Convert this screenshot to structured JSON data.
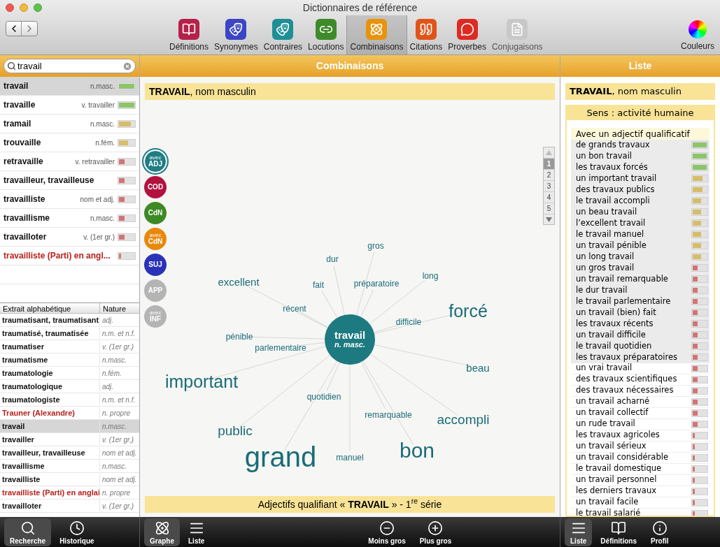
{
  "window": {
    "title": "Dictionnaires de référence"
  },
  "toolbar": [
    {
      "label": "Définitions",
      "kind": "book",
      "color": "#b5214a",
      "selected": false,
      "disabled": false
    },
    {
      "label": "Synonymes",
      "kind": "masks",
      "color": "#3b46c4",
      "selected": false,
      "disabled": false
    },
    {
      "label": "Contraires",
      "kind": "masks",
      "color": "#1f8f96",
      "selected": false,
      "disabled": false
    },
    {
      "label": "Locutions",
      "kind": "links",
      "color": "#3f8a2a",
      "selected": false,
      "disabled": false
    },
    {
      "label": "Combinaisons",
      "kind": "atom",
      "color": "#e8930c",
      "selected": true,
      "disabled": false
    },
    {
      "label": "Citations",
      "kind": "quote",
      "color": "#e0541a",
      "selected": false,
      "disabled": false
    },
    {
      "label": "Proverbes",
      "kind": "bubble",
      "color": "#dd2a22",
      "selected": false,
      "disabled": false
    },
    {
      "label": "Conjugaisons",
      "kind": "conj",
      "color": "#c8c8c8",
      "selected": false,
      "disabled": true
    }
  ],
  "colors_button": {
    "label": "Couleurs"
  },
  "search": {
    "value": "travail"
  },
  "panels": {
    "center": "Combinaisons",
    "right": "Liste"
  },
  "results": [
    {
      "word": "travail",
      "nature": "n.masc.",
      "level": 1,
      "kind": "common",
      "selected": true
    },
    {
      "word": "travaille",
      "nature": "v. travailler",
      "level": 1,
      "kind": "common",
      "selected": false
    },
    {
      "word": "tramail",
      "nature": "n.masc.",
      "level": 0.75,
      "kind": "common",
      "selected": false
    },
    {
      "word": "trouvaille",
      "nature": "n.fém.",
      "level": 0.6,
      "kind": "common",
      "selected": false
    },
    {
      "word": "retravaille",
      "nature": "v. retravailler",
      "level": 0.35,
      "kind": "common",
      "selected": false
    },
    {
      "word": "travailleur, travailleuse",
      "level": 0.35,
      "kind": "common",
      "selected": false
    },
    {
      "word": "travailliste",
      "nature": "nom et adj.",
      "level": 0.35,
      "kind": "common",
      "selected": false
    },
    {
      "word": "travaillisme",
      "nature": "n.masc.",
      "level": 0.35,
      "kind": "common",
      "selected": false
    },
    {
      "word": "travailloter",
      "nature": "v. (1er gr.)",
      "level": 0.35,
      "kind": "common",
      "selected": false
    },
    {
      "word": "travailliste (Parti) en angl...",
      "level": 0.15,
      "kind": "proper",
      "selected": false
    }
  ],
  "alpha_table": {
    "columns": [
      "Extrait alphabétique",
      "Nature"
    ],
    "rows": [
      {
        "word": "traumatisant, traumatisant",
        "nature": "adj.",
        "kind": "common",
        "selected": false
      },
      {
        "word": "traumatisé, traumatisée",
        "nature": "n.m. et n.f.",
        "kind": "common",
        "selected": false
      },
      {
        "word": "traumatiser",
        "nature": "v. (1er gr.)",
        "kind": "common",
        "selected": false
      },
      {
        "word": "traumatisme",
        "nature": "n.masc.",
        "kind": "common",
        "selected": false
      },
      {
        "word": "traumatologie",
        "nature": "n.fém.",
        "kind": "common",
        "selected": false
      },
      {
        "word": "traumatologique",
        "nature": "adj.",
        "kind": "common",
        "selected": false
      },
      {
        "word": "traumatologiste",
        "nature": "n.m. et n.f.",
        "kind": "common",
        "selected": false
      },
      {
        "word": "Trauner (Alexandre)",
        "nature": "n. propre",
        "kind": "proper",
        "selected": false
      },
      {
        "word": "travail",
        "nature": "n.masc.",
        "kind": "common",
        "selected": true
      },
      {
        "word": "travailler",
        "nature": "v. (1er gr.)",
        "kind": "common",
        "selected": false
      },
      {
        "word": "travailleur, travailleuse",
        "nature": "nom et adj.",
        "kind": "common",
        "selected": false
      },
      {
        "word": "travaillisme",
        "nature": "n.masc.",
        "kind": "common",
        "selected": false
      },
      {
        "word": "travailliste",
        "nature": "nom et adj.",
        "kind": "common",
        "selected": false
      },
      {
        "word": "travailliste (Parti) en anglai",
        "nature": "n. propre",
        "kind": "proper",
        "selected": false
      },
      {
        "word": "travailloter",
        "nature": "v. (1er gr.)",
        "kind": "common",
        "selected": false
      }
    ]
  },
  "graph": {
    "heading": "**TRAVAIL**, nom masculin",
    "relations": [
      {
        "prefix": "avec",
        "label": "ADJ",
        "color": "#1f7d84",
        "selected": true
      },
      {
        "label": "COD",
        "color": "#b3123f",
        "selected": false
      },
      {
        "label": "CdN",
        "color": "#3d8a24",
        "selected": false
      },
      {
        "prefix": "avec",
        "label": "CdN",
        "color": "#e8880c",
        "selected": false
      },
      {
        "label": "SUJ",
        "color": "#2a33b8",
        "selected": false
      },
      {
        "label": "APP",
        "color": "#b4b4b4",
        "selected": false
      },
      {
        "prefix": "avec",
        "label": "INF",
        "color": "#b4b4b4",
        "selected": false
      }
    ],
    "pages": [
      {
        "label": "1",
        "selected": true
      },
      {
        "label": "2",
        "selected": false
      },
      {
        "label": "3",
        "selected": false
      },
      {
        "label": "4",
        "selected": false
      },
      {
        "label": "5",
        "selected": false
      }
    ],
    "center": {
      "word": "travail",
      "nature": "n. masc."
    },
    "words": [
      {
        "text": "gros",
        "kind": "small"
      },
      {
        "text": "dur",
        "kind": "small"
      },
      {
        "text": "long",
        "kind": "small"
      },
      {
        "text": "excellent",
        "kind": "medium"
      },
      {
        "text": "fait",
        "kind": "small"
      },
      {
        "text": "préparatoire",
        "kind": "small"
      },
      {
        "text": "récent",
        "kind": "small"
      },
      {
        "text": "forcé",
        "kind": "large"
      },
      {
        "text": "difficile",
        "kind": "small"
      },
      {
        "text": "pénible",
        "kind": "small"
      },
      {
        "text": "parlementaire",
        "kind": "small"
      },
      {
        "text": "beau",
        "kind": "medium"
      },
      {
        "text": "important",
        "kind": "large"
      },
      {
        "text": "quotidien",
        "kind": "small"
      },
      {
        "text": "remarquable",
        "kind": "small"
      },
      {
        "text": "accompli",
        "kind": "big"
      },
      {
        "text": "public",
        "kind": "big"
      },
      {
        "text": "grand",
        "kind": "huge"
      },
      {
        "text": "manuel",
        "kind": "small"
      },
      {
        "text": "bon",
        "kind": "xlarge"
      }
    ],
    "caption": "Adjectifs qualifiant « **TRAVAIL** » - 1$^{re}$ série"
  },
  "liste": {
    "heading": "**TRAVAIL**, nom masculin",
    "sense": "Sens : activité humaine",
    "group": "Avec un adjectif qualificatif",
    "items": [
      {
        "text": "de grands travaux",
        "level": 1,
        "highlighted": true
      },
      {
        "text": "un bon travail",
        "level": 1,
        "highlighted": true
      },
      {
        "text": "les travaux forcés",
        "level": 1,
        "highlighted": true
      },
      {
        "text": "un important travail",
        "level": 0.7,
        "highlighted": true
      },
      {
        "text": "des travaux publics",
        "level": 0.7,
        "highlighted": true
      },
      {
        "text": "le travail accompli",
        "level": 0.6,
        "highlighted": true
      },
      {
        "text": "un beau travail",
        "level": 0.6,
        "highlighted": true
      },
      {
        "text": "l’excellent travail",
        "level": 0.6,
        "highlighted": true
      },
      {
        "text": "le travail manuel",
        "level": 0.6,
        "highlighted": true
      },
      {
        "text": "un travail pénible",
        "level": 0.6,
        "highlighted": true
      },
      {
        "text": "un long travail",
        "level": 0.6,
        "highlighted": true
      },
      {
        "text": "un gros travail",
        "level": 0.35,
        "highlighted": true
      },
      {
        "text": "un travail remarquable",
        "level": 0.35,
        "highlighted": true
      },
      {
        "text": "le dur travail",
        "level": 0.35,
        "highlighted": true
      },
      {
        "text": "le travail parlementaire",
        "level": 0.35,
        "highlighted": true
      },
      {
        "text": "un travail (bien) fait",
        "level": 0.35,
        "highlighted": true
      },
      {
        "text": "les travaux récents",
        "level": 0.35,
        "highlighted": true
      },
      {
        "text": "un travail difficile",
        "level": 0.35,
        "highlighted": true
      },
      {
        "text": "le travail quotidien",
        "level": 0.35,
        "highlighted": true
      },
      {
        "text": "les travaux préparatoires",
        "level": 0.35,
        "highlighted": true
      },
      {
        "text": "un vrai travail",
        "level": 0.35,
        "highlighted": false
      },
      {
        "text": "des travaux scientifiques",
        "level": 0.35,
        "highlighted": false
      },
      {
        "text": "des travaux nécessaires",
        "level": 0.35,
        "highlighted": false
      },
      {
        "text": "un travail acharné",
        "level": 0.35,
        "highlighted": false
      },
      {
        "text": "un travail collectif",
        "level": 0.35,
        "highlighted": false
      },
      {
        "text": "un rude travail",
        "level": 0.35,
        "highlighted": false
      },
      {
        "text": "les travaux agricoles",
        "level": 0.15,
        "highlighted": false
      },
      {
        "text": "un travail sérieux",
        "level": 0.15,
        "highlighted": false
      },
      {
        "text": "un travail considérable",
        "level": 0.15,
        "highlighted": false
      },
      {
        "text": "le travail domestique",
        "level": 0.15,
        "highlighted": false
      },
      {
        "text": "un travail personnel",
        "level": 0.15,
        "highlighted": false
      },
      {
        "text": "les derniers travaux",
        "level": 0.15,
        "highlighted": false
      },
      {
        "text": "un travail facile",
        "level": 0.15,
        "highlighted": false
      },
      {
        "text": "le travail salarié",
        "level": 0.15,
        "highlighted": false
      }
    ]
  },
  "bottom_left": [
    {
      "label": "Recherche",
      "kind": "search",
      "selected": true
    },
    {
      "label": "Historique",
      "kind": "clock",
      "selected": false
    }
  ],
  "bottom_center": [
    {
      "label": "Graphe",
      "kind": "atom",
      "selected": true
    },
    {
      "label": "Liste",
      "kind": "list",
      "selected": false
    },
    {
      "label": "Moins gros",
      "kind": "smaller",
      "selected": false
    },
    {
      "label": "Plus gros",
      "kind": "bigger",
      "selected": false
    }
  ],
  "bottom_right": [
    {
      "label": "Liste",
      "kind": "list",
      "selected": true
    },
    {
      "label": "Définitions",
      "kind": "book",
      "selected": false
    },
    {
      "label": "Profil",
      "kind": "info",
      "selected": false
    }
  ]
}
